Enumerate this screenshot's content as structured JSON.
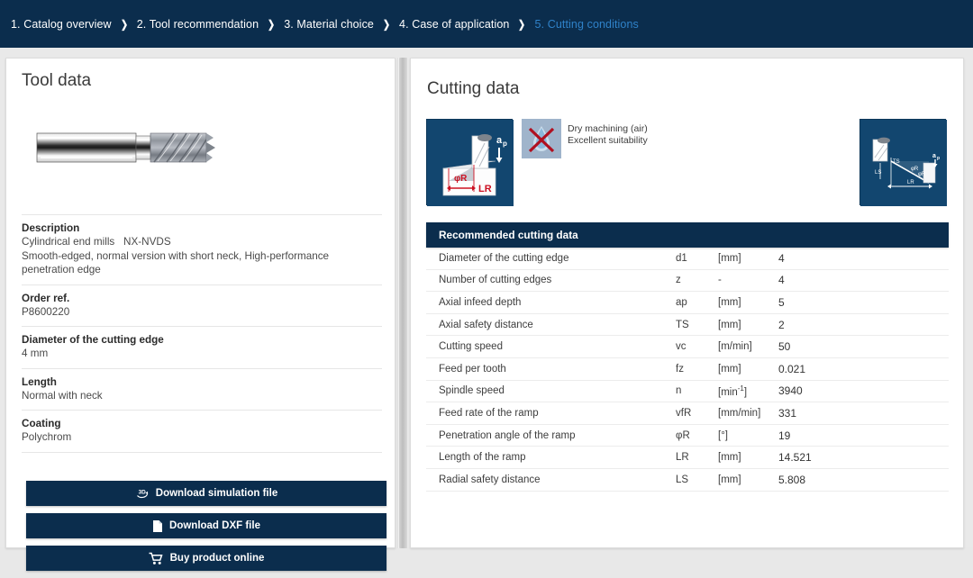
{
  "breadcrumb": {
    "separator_icon": "chevron-right-icon",
    "items": [
      {
        "label": "1. Catalog overview",
        "active": false
      },
      {
        "label": "2. Tool recommendation",
        "active": false
      },
      {
        "label": "3. Material choice",
        "active": false
      },
      {
        "label": "4. Case of application",
        "active": false
      },
      {
        "label": "5. Cutting conditions",
        "active": true
      }
    ],
    "active_color": "#2f82c9",
    "background_color": "#0b2d4d"
  },
  "tool_panel": {
    "title": "Tool data",
    "image_alt": "cylindrical-end-mill",
    "specs": [
      {
        "label": "Description",
        "value": "Cylindrical end mills   NX-NVDS\nSmooth-edged, normal version with short neck, High-performance penetration edge"
      },
      {
        "label": "Order ref.",
        "value": "P8600220"
      },
      {
        "label": "Diameter of the cutting edge",
        "value": "4 mm"
      },
      {
        "label": "Length",
        "value": "Normal with neck"
      },
      {
        "label": "Coating",
        "value": "Polychrom"
      }
    ],
    "buttons": [
      {
        "label": "Download simulation file",
        "icon": "3d-rotate-icon"
      },
      {
        "label": "Download DXF file",
        "icon": "document-icon"
      },
      {
        "label": "Buy product online",
        "icon": "shopping-cart-icon"
      }
    ]
  },
  "cutting_panel": {
    "title": "Cutting data",
    "diagram_left_alt": "ramp-angle-diagram",
    "diagram_right_alt": "ramp-length-diagram",
    "coolant": {
      "icon": "no-coolant-icon",
      "line1": "Dry machining (air)",
      "line2": "Excellent suitability"
    },
    "table": {
      "header": "Recommended cutting data",
      "rows": [
        {
          "name": "Diameter of the cutting edge",
          "symbol": "d1",
          "unit": "[mm]",
          "value": "4"
        },
        {
          "name": "Number of cutting edges",
          "symbol": "z",
          "unit": "-",
          "value": "4"
        },
        {
          "name": "Axial infeed depth",
          "symbol": "ap",
          "unit": "[mm]",
          "value": "5"
        },
        {
          "name": "Axial safety distance",
          "symbol": "TS",
          "unit": "[mm]",
          "value": "2"
        },
        {
          "name": "Cutting speed",
          "symbol": "vc",
          "unit": "[m/min]",
          "value": "50"
        },
        {
          "name": "Feed per tooth",
          "symbol": "fz",
          "unit": "[mm]",
          "value": "0.021"
        },
        {
          "name": "Spindle speed",
          "symbol": "n",
          "unit": "[min-1]",
          "unit_base": "[min",
          "unit_sup": "-1",
          "unit_tail": "]",
          "value": "3940"
        },
        {
          "name": "Feed rate of the ramp",
          "symbol": "vfR",
          "unit": "[mm/min]",
          "value": "331"
        },
        {
          "name": "Penetration angle of the ramp",
          "symbol": "φR",
          "unit": "[°]",
          "value": "19"
        },
        {
          "name": "Length of the ramp",
          "symbol": "LR",
          "unit": "[mm]",
          "value": "14.521"
        },
        {
          "name": "Radial safety distance",
          "symbol": "LS",
          "unit": "[mm]",
          "value": "5.808"
        }
      ]
    }
  }
}
